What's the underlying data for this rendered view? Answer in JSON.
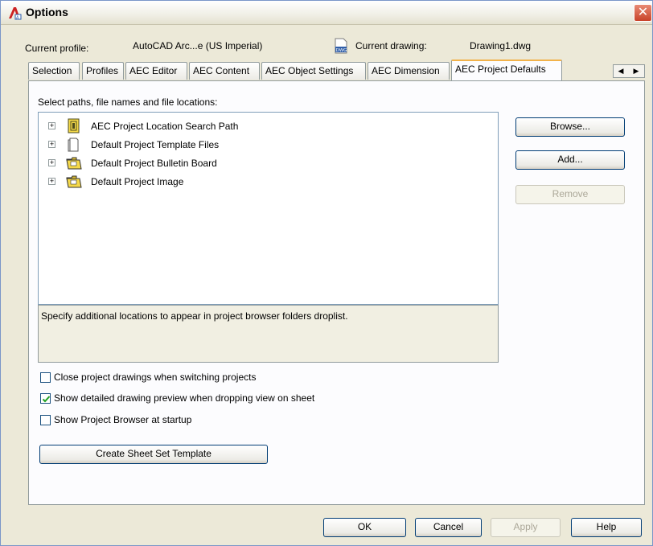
{
  "window": {
    "title": "Options"
  },
  "profile": {
    "label": "Current profile:",
    "value": "AutoCAD Arc...e (US Imperial)"
  },
  "drawing": {
    "label": "Current drawing:",
    "value": "Drawing1.dwg",
    "icon_text": "DWG"
  },
  "tabs": [
    "Selection",
    "Profiles",
    "AEC Editor",
    "AEC Content",
    "AEC Object Settings",
    "AEC Dimension",
    "AEC Project Defaults"
  ],
  "active_tab": "AEC Project Defaults",
  "panel": {
    "heading": "Select paths, file names and file locations:",
    "tree_items": [
      {
        "label": "AEC Project Location Search Path",
        "icon": "project-location-icon"
      },
      {
        "label": "Default Project Template Files",
        "icon": "template-file-icon"
      },
      {
        "label": "Default Project Bulletin Board",
        "icon": "folder-icon"
      },
      {
        "label": "Default Project Image",
        "icon": "folder-icon"
      }
    ],
    "description": "Specify additional locations to appear in project browser folders droplist.",
    "buttons": {
      "browse": "Browse...",
      "add": "Add...",
      "remove": "Remove"
    },
    "checkboxes": [
      {
        "label": "Close project drawings when switching projects",
        "checked": false
      },
      {
        "label": "Show detailed drawing preview when dropping view on sheet",
        "checked": true
      },
      {
        "label": "Show Project Browser at startup",
        "checked": false
      }
    ],
    "create_template": "Create Sheet Set Template"
  },
  "footer": {
    "ok": "OK",
    "cancel": "Cancel",
    "apply": "Apply",
    "help": "Help"
  },
  "colors": {
    "accent": "#f2b24a",
    "close": "#c8432a",
    "folder": "#f5d94a"
  }
}
